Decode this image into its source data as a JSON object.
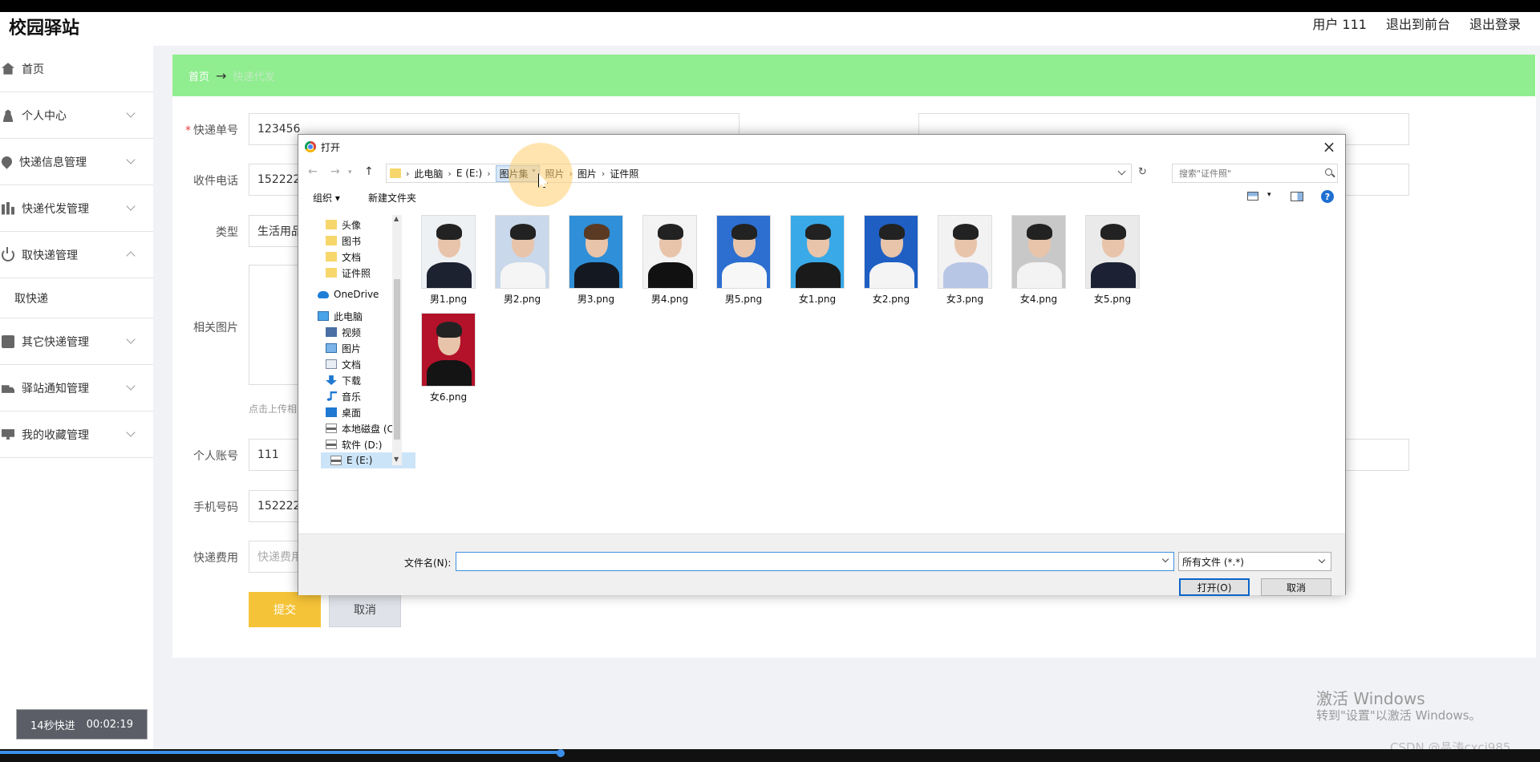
{
  "app": {
    "brand": "校园驿站",
    "nav": [
      "用户 111",
      "退出到前台",
      "退出登录"
    ]
  },
  "sidebar": {
    "items": [
      {
        "label": "首页",
        "icon": "home-icon"
      },
      {
        "label": "个人中心",
        "icon": "user-icon"
      },
      {
        "label": "快递信息管理",
        "icon": "location-pin-icon"
      },
      {
        "label": "快递代发管理",
        "icon": "bar-chart-icon"
      },
      {
        "label": "取快递管理",
        "icon": "power-icon"
      },
      {
        "label": "取快递",
        "icon": ""
      },
      {
        "label": "其它快递管理",
        "icon": "clipboard-icon"
      },
      {
        "label": "驿站通知管理",
        "icon": "truck-icon"
      },
      {
        "label": "我的收藏管理",
        "icon": "monitor-icon"
      }
    ]
  },
  "breadcrumb": {
    "home": "首页",
    "arrow": "→",
    "current": "快递代发"
  },
  "form": {
    "tracking_label": "快递单号",
    "tracking_value": "123456",
    "phone_label": "收件电话",
    "phone_value": "152222",
    "type_label": "类型",
    "type_value": "生活用品",
    "images_label": "相关图片",
    "upload_hint": "点击上传相关图片",
    "account_label": "个人账号",
    "account_value": "111",
    "mobile_label": "手机号码",
    "mobile_value": "152222",
    "fee_label": "快递费用",
    "fee_placeholder": "快递费用",
    "submit": "提交",
    "cancel": "取消"
  },
  "dialog": {
    "title": "打开",
    "address": [
      "此电脑",
      "E (E:)",
      "图片集",
      "照片",
      "图片",
      "证件照"
    ],
    "search_placeholder": "搜索\"证件照\"",
    "organize": "组织 ▾",
    "new_folder": "新建文件夹",
    "nav": [
      {
        "label": "头像",
        "icon": "folder-icon"
      },
      {
        "label": "图书",
        "icon": "folder-icon"
      },
      {
        "label": "文档",
        "icon": "folder-icon"
      },
      {
        "label": "证件照",
        "icon": "folder-icon"
      },
      {
        "label": "OneDrive",
        "icon": "cloud-icon"
      },
      {
        "label": "此电脑",
        "icon": "computer-icon"
      },
      {
        "label": "视频",
        "icon": "video-icon"
      },
      {
        "label": "图片",
        "icon": "pictures-icon"
      },
      {
        "label": "文档",
        "icon": "document-icon"
      },
      {
        "label": "下载",
        "icon": "download-icon"
      },
      {
        "label": "音乐",
        "icon": "music-icon"
      },
      {
        "label": "桌面",
        "icon": "desktop-icon"
      },
      {
        "label": "本地磁盘 (C:)",
        "icon": "drive-icon"
      },
      {
        "label": "软件 (D:)",
        "icon": "drive-icon"
      },
      {
        "label": "E (E:)",
        "icon": "drive-icon"
      }
    ],
    "files": [
      "男1.png",
      "男2.png",
      "男3.png",
      "男4.png",
      "男5.png",
      "女1.png",
      "女2.png",
      "女3.png",
      "女4.png",
      "女5.png",
      "女6.png"
    ],
    "filename_label": "文件名(N):",
    "filename_value": "",
    "filetype": "所有文件 (*.*)",
    "open": "打开(O)",
    "cancel": "取消"
  },
  "overlay": {
    "timer_label": "14秒快进",
    "timer_time": "00:02:19",
    "watermark_title": "激活 Windows",
    "watermark_sub": "转到\"设置\"以激活 Windows。",
    "csdn": "CSDN @晶涛cxcj985"
  },
  "colors": {
    "breadcrumb_bg": "#90ee90",
    "submit_bg": "#f5c338",
    "cancel_bg": "#dfe3e9"
  }
}
